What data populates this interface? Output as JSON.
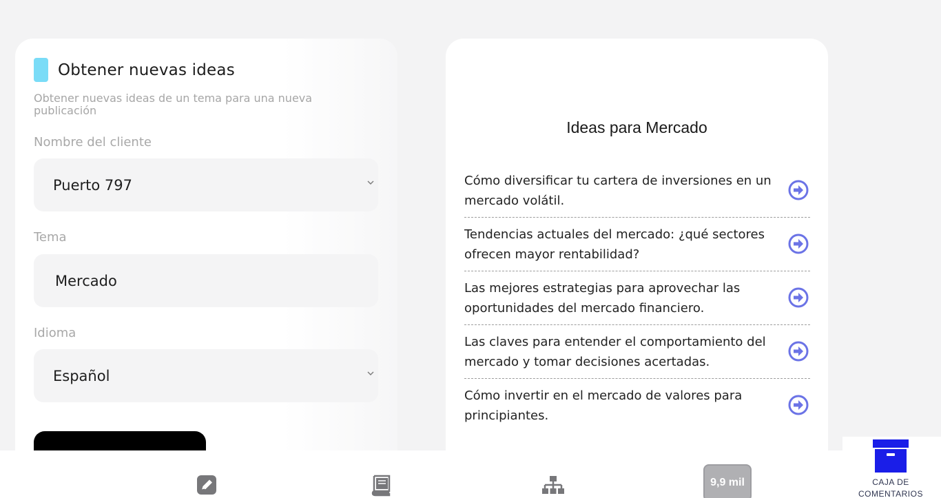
{
  "form": {
    "title": "Obtener nuevas ideas",
    "subtitle": "Obtener nuevas ideas de un tema para una nueva publicación",
    "client_label": "Nombre del cliente",
    "client_value": "Puerto 797",
    "topic_label": "Tema",
    "topic_value": "Mercado",
    "language_label": "Idioma",
    "language_value": "Español",
    "accent_color": "#7adcf7"
  },
  "ideas": {
    "title": "Ideas para Mercado",
    "items": [
      "Cómo diversificar tu cartera de inversiones en un mercado volátil.",
      "Tendencias actuales del mercado: ¿qué sectores ofrecen mayor rentabilidad?",
      "Las mejores estrategias para aprovechar las oportunidades del mercado financiero.",
      "Las claves para entender el comportamiento del mercado y tomar decisiones acertadas.",
      "Cómo invertir en el mercado de valores para principiantes."
    ],
    "arrow_icon": "arrow-circle-right-icon",
    "arrow_color": "#6b73e6"
  },
  "bottom_nav": {
    "items": [
      "pencil-icon",
      "book-icon",
      "sitemap-icon"
    ],
    "count_badge": "9,9 mil"
  },
  "comment_box": {
    "label": "CAJA DE COMENTARIOS",
    "icon": "archive-box-icon",
    "color": "#1a1ee8"
  }
}
